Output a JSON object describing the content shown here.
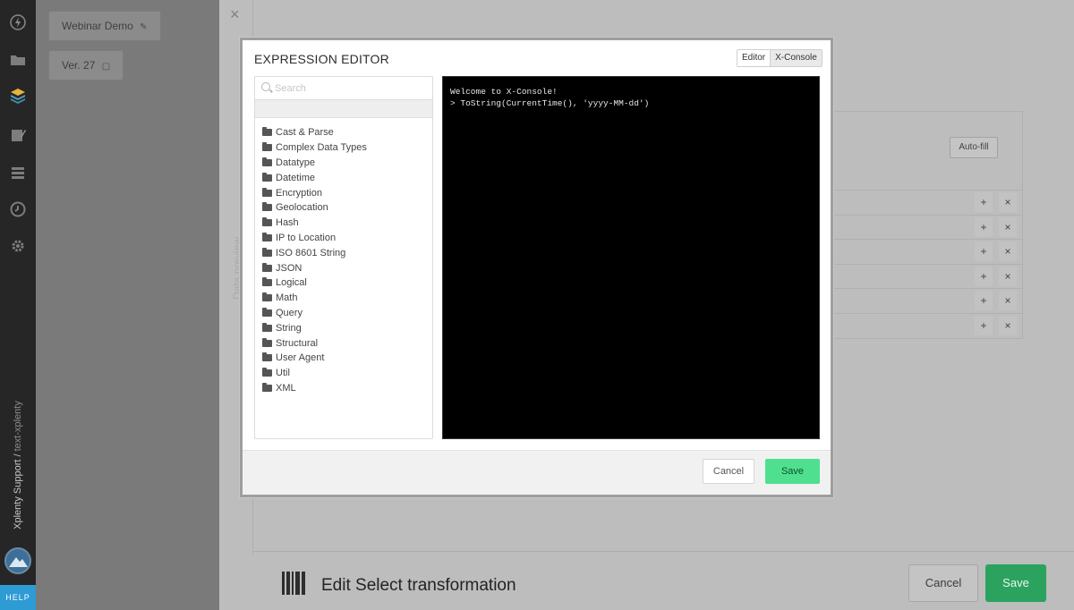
{
  "sidebar": {
    "icons": [
      "bolt-icon",
      "folder-icon",
      "layers-icon",
      "edit-icon",
      "list-icon",
      "clock-icon",
      "gear-icon"
    ],
    "org_label": "Xplenty Support /",
    "org_sub": "text-xplenty",
    "help": "HELP"
  },
  "package": {
    "name": "Webinar Demo",
    "version": "Ver. 27"
  },
  "background": {
    "vertical_label": "Data preview",
    "autofill": "Auto-fill",
    "row_add": "+",
    "row_remove": "×",
    "rows": 6,
    "title": "Edit Select transformation",
    "cancel": "Cancel",
    "save": "Save"
  },
  "modal": {
    "title": "EXPRESSION EDITOR",
    "tabs": [
      "Editor",
      "X-Console"
    ],
    "active_tab": "X-Console",
    "search_placeholder": "Search",
    "categories": [
      "Cast & Parse",
      "Complex Data Types",
      "Datatype",
      "Datetime",
      "Encryption",
      "Geolocation",
      "Hash",
      "IP to Location",
      "ISO 8601 String",
      "JSON",
      "Logical",
      "Math",
      "Query",
      "String",
      "Structural",
      "User Agent",
      "Util",
      "XML"
    ],
    "console_lines": [
      "Welcome to X-Console!",
      "> ToString(CurrentTime(), 'yyyy-MM-dd')"
    ],
    "cancel": "Cancel",
    "save": "Save"
  },
  "colors": {
    "accent_green": "#4ee08f",
    "help_blue": "#2d9bd4",
    "console_bg": "#000000"
  }
}
